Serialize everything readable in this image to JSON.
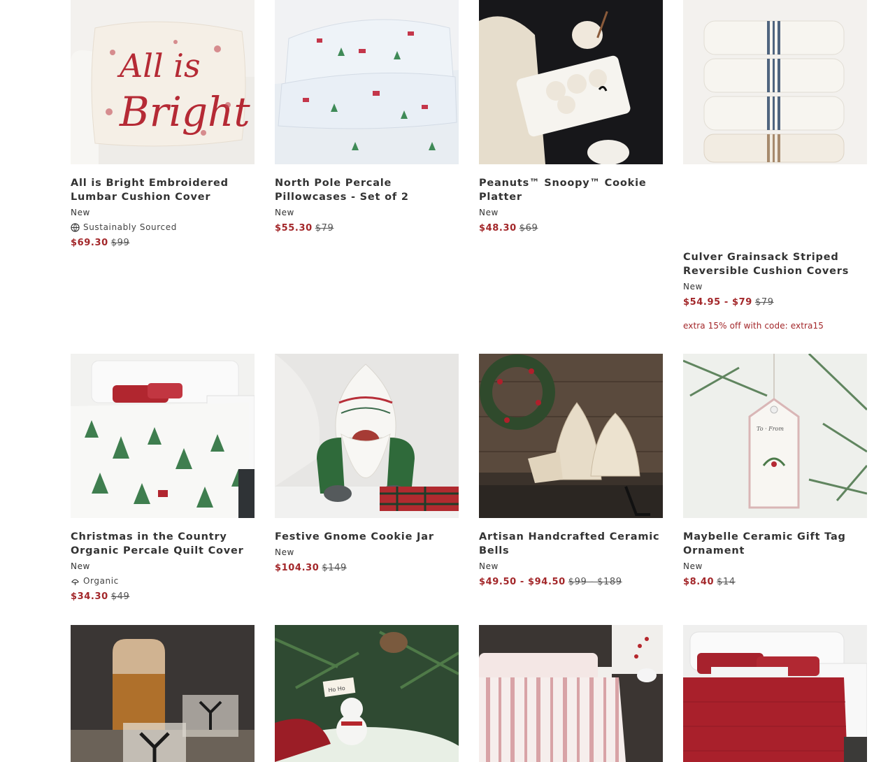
{
  "colors": {
    "sale": "#a3272a",
    "text": "#333333"
  },
  "products": [
    {
      "name": "All is Bright Embroidered Lumbar Cushion Cover",
      "flag": "New",
      "attr_icon": "globe-icon",
      "attr": "Sustainably Sourced",
      "sale": "$69.30",
      "orig": "$99"
    },
    {
      "name": "North Pole Percale Pillowcases - Set of 2",
      "flag": "New",
      "sale": "$55.30",
      "orig": "$79"
    },
    {
      "name": "Peanuts™ Snoopy™ Cookie Platter",
      "flag": "New",
      "sale": "$48.30",
      "orig": "$69"
    },
    {
      "name": "Culver Grainsack Striped Reversible Cushion Covers",
      "flag": "New",
      "sale": "$54.95 - $79",
      "orig": "$79",
      "promo": "extra 15% off with code: extra15"
    },
    {
      "name": "Christmas in the Country Organic Percale Quilt Cover",
      "flag": "New",
      "attr_icon": "leaf-icon",
      "attr": "Organic",
      "sale": "$34.30",
      "orig": "$49"
    },
    {
      "name": "Festive Gnome Cookie Jar",
      "flag": "New",
      "sale": "$104.30",
      "orig": "$149"
    },
    {
      "name": "Artisan Handcrafted Ceramic Bells",
      "flag": "New",
      "sale": "$49.50 - $94.50",
      "orig": "$99 - $189"
    },
    {
      "name": "Maybelle Ceramic Gift Tag Ornament",
      "flag": "New",
      "sale": "$8.40",
      "orig": "$14"
    }
  ],
  "images": [
    "embroidered-cushion-image",
    "pillowcases-image",
    "cookie-platter-image",
    "striped-cushions-image",
    "quilt-bed-image",
    "gnome-jar-image",
    "ceramic-bells-image",
    "gift-tag-ornament-image",
    "whiskey-glasses-image",
    "snowman-centerpiece-image",
    "striped-bedding-image",
    "red-quilt-bedding-image"
  ]
}
